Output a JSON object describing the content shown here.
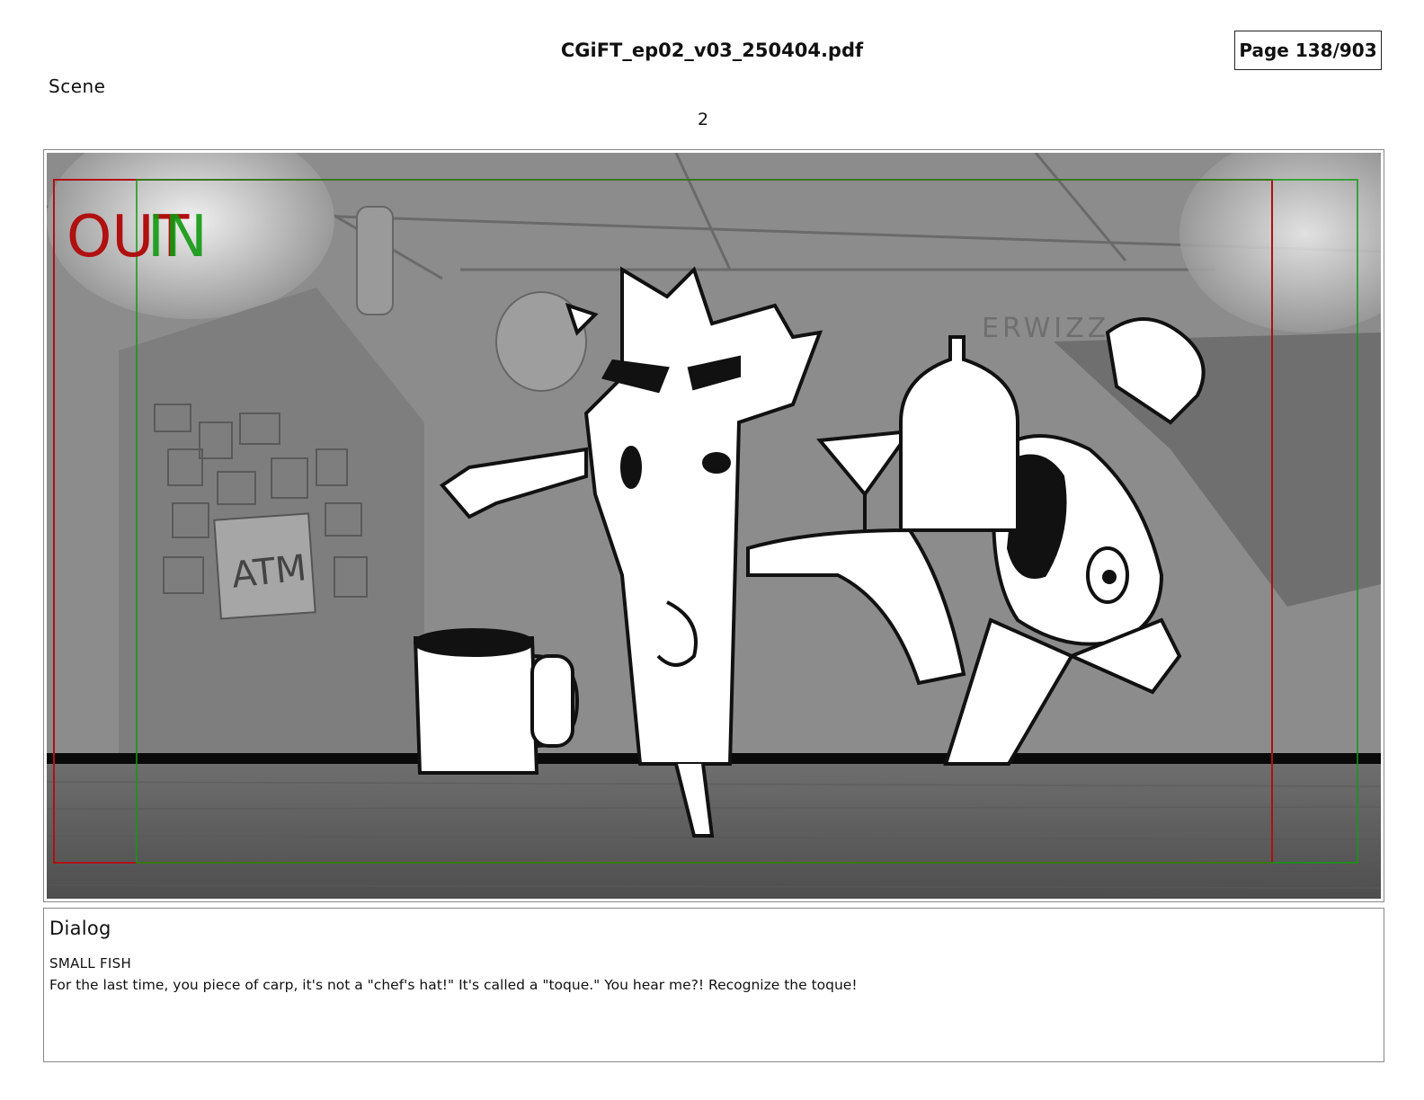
{
  "header": {
    "file_title": "CGiFT_ep02_v03_250404.pdf",
    "page_indicator": "Page 138/903"
  },
  "scene": {
    "label": "Scene",
    "number": "2"
  },
  "panel": {
    "safe_marks": {
      "out": "OUT",
      "in": "IN"
    },
    "out_color": "#b01010",
    "in_color": "#119a11",
    "sign_text": "ATM",
    "bg_sign_text": "ERWIZZ"
  },
  "dialog": {
    "label": "Dialog",
    "speaker": "SMALL FISH",
    "line": "For the last time, you piece of carp, it's not a \"chef's hat!\" It's called a \"toque.\" You hear me?! Recognize the toque!"
  }
}
